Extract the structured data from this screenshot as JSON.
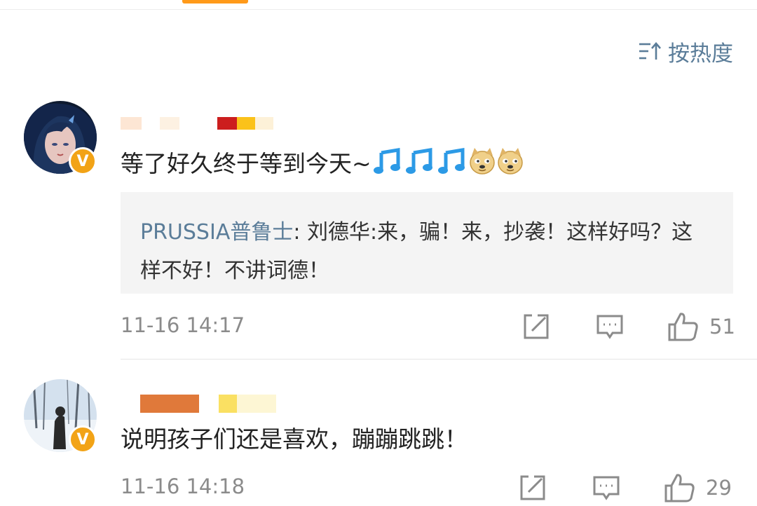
{
  "header": {
    "sort_label": "按热度",
    "sort_icon": "sort-icon"
  },
  "comments": [
    {
      "text": "等了好久终于等到今天~",
      "emojis": [
        "music-note-icon",
        "music-note-icon",
        "music-note-icon",
        "doge-icon",
        "doge-icon"
      ],
      "verified_badge": "V",
      "reply": {
        "author": "PRUSSIA普鲁士",
        "separator": ": ",
        "text": "刘德华:来，骗！来，抄袭！这样好吗？这样不好！不讲词德！"
      },
      "time": "11-16 14:17",
      "like_count": "51"
    },
    {
      "text": "说明孩子们还是喜欢，蹦蹦跳跳！",
      "verified_badge": "V",
      "time": "11-16 14:18",
      "like_count": "29"
    }
  ],
  "colors": {
    "accent": "#ff9a1a",
    "link": "#5b7d99",
    "meta": "#8b8b8b",
    "quote_bg": "#f4f4f4",
    "badge": "#f2a316"
  }
}
